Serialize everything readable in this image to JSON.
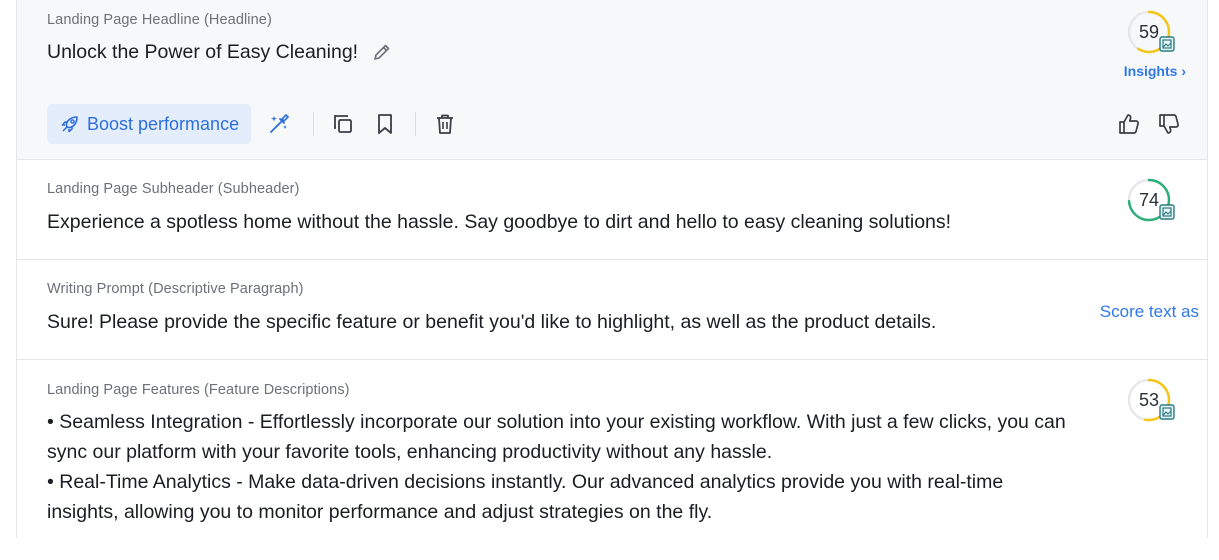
{
  "cards": [
    {
      "label": "Landing Page Headline (Headline)",
      "text": "Unlock the Power of Easy Cleaning!",
      "score": "59",
      "score_fraction": 0.59,
      "score_color": "#f5c518",
      "insights": "Insights ›"
    },
    {
      "label": "Landing Page Subheader (Subheader)",
      "text": "Experience a spotless home without the hassle. Say goodbye to dirt and hello to easy cleaning solutions!",
      "score": "74",
      "score_fraction": 0.74,
      "score_color": "#2fae7a"
    },
    {
      "label": "Writing Prompt (Descriptive Paragraph)",
      "text": "Sure! Please provide the specific feature or benefit you'd like to highlight, as well as the product details.",
      "score_text_as": "Score text as"
    },
    {
      "label": "Landing Page Features (Feature Descriptions)",
      "lines": [
        "• Seamless Integration - Effortlessly incorporate our solution into your existing workflow. With just a few clicks, you can",
        "sync our platform with your favorite tools, enhancing productivity without any hassle.",
        "• Real-Time Analytics - Make data-driven decisions instantly. Our advanced analytics provide you with real-time",
        "insights, allowing you to monitor performance and adjust strategies on the fly."
      ],
      "score": "53",
      "score_fraction": 0.53,
      "score_color": "#f5c518"
    }
  ],
  "toolbar": {
    "boost_label": "Boost performance",
    "icons": [
      "rocket-icon",
      "magic-wand-icon",
      "copy-icon",
      "bookmark-icon",
      "trash-icon",
      "thumbs-up-icon",
      "thumbs-down-icon",
      "edit-pencil-icon",
      "image-badge-icon"
    ]
  },
  "colors": {
    "accent": "#2f78e8",
    "boost_bg": "#e4edfb",
    "active_bg": "#f7f8fa",
    "ring_track": "#e6e8eb"
  }
}
